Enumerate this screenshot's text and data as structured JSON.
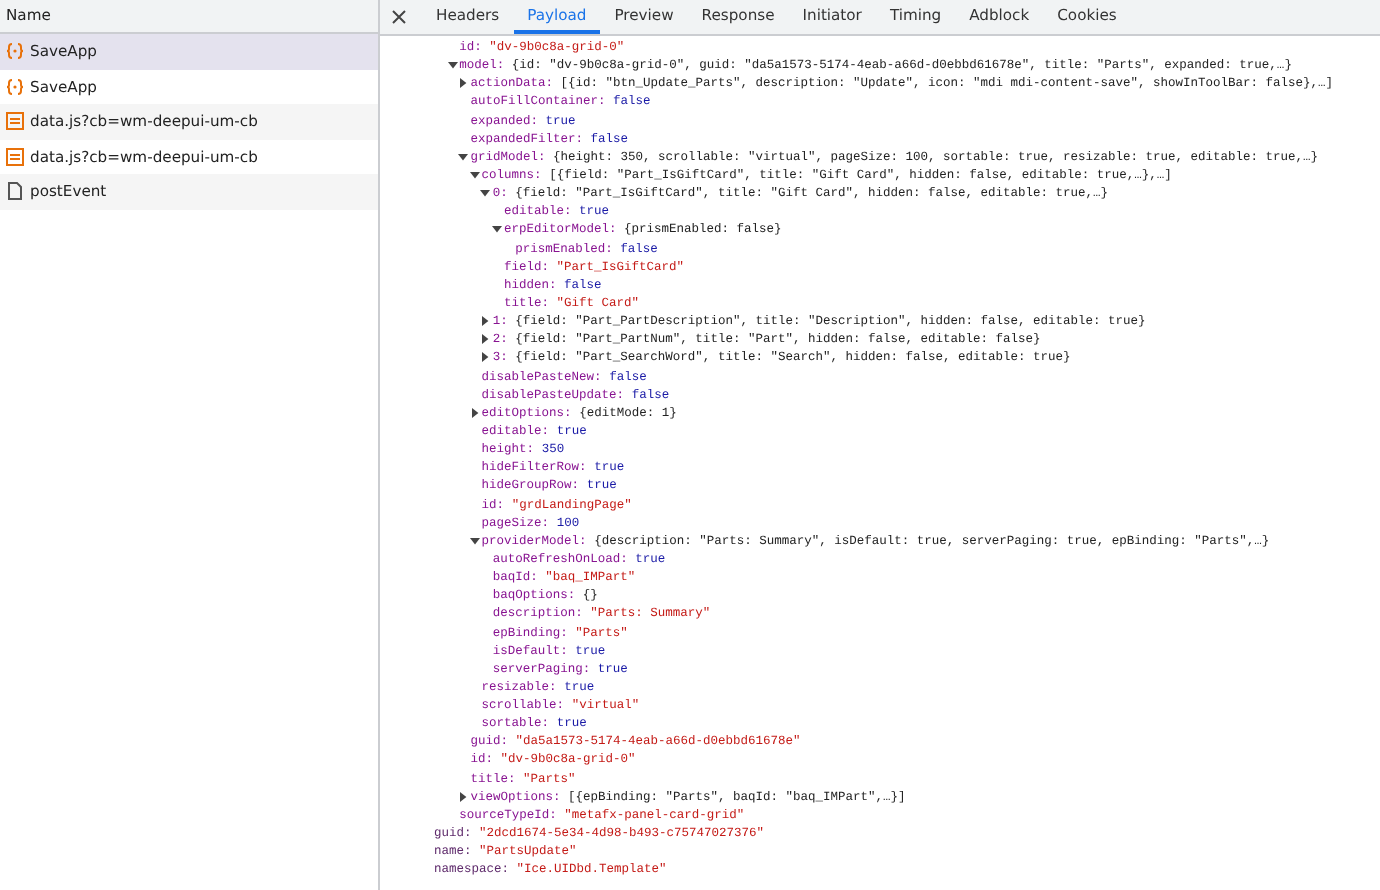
{
  "requests": {
    "header": "Name",
    "items": [
      {
        "name": "SaveApp",
        "kind": "xhr",
        "selected": true
      },
      {
        "name": "SaveApp",
        "kind": "xhr",
        "selected": false
      },
      {
        "name": "data.js?cb=wm-deepui-um-cb",
        "kind": "script",
        "selected": false
      },
      {
        "name": "data.js?cb=wm-deepui-um-cb",
        "kind": "script",
        "selected": false
      },
      {
        "name": "postEvent",
        "kind": "doc",
        "selected": false
      }
    ]
  },
  "tabs": [
    {
      "label": "Headers",
      "selected": false
    },
    {
      "label": "Payload",
      "selected": true
    },
    {
      "label": "Preview",
      "selected": false
    },
    {
      "label": "Response",
      "selected": false
    },
    {
      "label": "Initiator",
      "selected": false
    },
    {
      "label": "Timing",
      "selected": false
    },
    {
      "label": "Adblock",
      "selected": false
    },
    {
      "label": "Cookies",
      "selected": false
    }
  ],
  "tree": [
    {
      "children": [
        {
          "key": "id:",
          "value": "\"dv-9b0c8a-grid-0\"",
          "kind": "string"
        },
        {
          "key": "model:",
          "value": "{id: \"dv-9b0c8a-grid-0\", guid: \"da5a1573-5174-4eab-a66d-d0ebbd61678e\", title: \"Parts\", expanded: true,…}",
          "kind": "object",
          "expanded": true,
          "children": [
            {
              "key": "actionData:",
              "value": "[{id: \"btn_Update_Parts\", description: \"Update\", icon: \"mdi mdi-content-save\", showInToolBar: false},…]",
              "kind": "object",
              "expanded": false
            },
            {
              "key": "autoFillContainer:",
              "value": "false",
              "kind": "literal"
            },
            {
              "key": "expanded:",
              "value": "true",
              "kind": "literal"
            },
            {
              "key": "expandedFilter:",
              "value": "false",
              "kind": "literal"
            },
            {
              "key": "gridModel:",
              "value": "{height: 350, scrollable: \"virtual\", pageSize: 100, sortable: true, resizable: true, editable: true,…}",
              "kind": "object",
              "expanded": true,
              "children": [
                {
                  "key": "columns:",
                  "value": "[{field: \"Part_IsGiftCard\", title: \"Gift Card\", hidden: false, editable: true,…},…]",
                  "kind": "object",
                  "expanded": true,
                  "children": [
                    {
                      "key": "0:",
                      "value": "{field: \"Part_IsGiftCard\", title: \"Gift Card\", hidden: false, editable: true,…}",
                      "kind": "object",
                      "expanded": true,
                      "children": [
                        {
                          "key": "editable:",
                          "value": "true",
                          "kind": "literal"
                        },
                        {
                          "key": "erpEditorModel:",
                          "value": "{prismEnabled: false}",
                          "kind": "object",
                          "expanded": true,
                          "children": [
                            {
                              "key": "prismEnabled:",
                              "value": "false",
                              "kind": "literal"
                            }
                          ]
                        },
                        {
                          "key": "field:",
                          "value": "\"Part_IsGiftCard\"",
                          "kind": "string"
                        },
                        {
                          "key": "hidden:",
                          "value": "false",
                          "kind": "literal"
                        },
                        {
                          "key": "title:",
                          "value": "\"Gift Card\"",
                          "kind": "string"
                        }
                      ]
                    },
                    {
                      "key": "1:",
                      "value": "{field: \"Part_PartDescription\", title: \"Description\", hidden: false, editable: true}",
                      "kind": "object",
                      "expanded": false
                    },
                    {
                      "key": "2:",
                      "value": "{field: \"Part_PartNum\", title: \"Part\", hidden: false, editable: false}",
                      "kind": "object",
                      "expanded": false
                    },
                    {
                      "key": "3:",
                      "value": "{field: \"Part_SearchWord\", title: \"Search\", hidden: false, editable: true}",
                      "kind": "object",
                      "expanded": false
                    }
                  ]
                },
                {
                  "key": "disablePasteNew:",
                  "value": "false",
                  "kind": "literal"
                },
                {
                  "key": "disablePasteUpdate:",
                  "value": "false",
                  "kind": "literal"
                },
                {
                  "key": "editOptions:",
                  "value": "{editMode: 1}",
                  "kind": "object",
                  "expanded": false
                },
                {
                  "key": "editable:",
                  "value": "true",
                  "kind": "literal"
                },
                {
                  "key": "height:",
                  "value": "350",
                  "kind": "literal"
                },
                {
                  "key": "hideFilterRow:",
                  "value": "true",
                  "kind": "literal"
                },
                {
                  "key": "hideGroupRow:",
                  "value": "true",
                  "kind": "literal"
                },
                {
                  "key": "id:",
                  "value": "\"grdLandingPage\"",
                  "kind": "string"
                },
                {
                  "key": "pageSize:",
                  "value": "100",
                  "kind": "literal"
                },
                {
                  "key": "providerModel:",
                  "value": "{description: \"Parts: Summary\", isDefault: true, serverPaging: true, epBinding: \"Parts\",…}",
                  "kind": "object",
                  "expanded": true,
                  "children": [
                    {
                      "key": "autoRefreshOnLoad:",
                      "value": "true",
                      "kind": "literal"
                    },
                    {
                      "key": "baqId:",
                      "value": "\"baq_IMPart\"",
                      "kind": "string"
                    },
                    {
                      "key": "baqOptions:",
                      "value": "{}",
                      "kind": "object"
                    },
                    {
                      "key": "description:",
                      "value": "\"Parts: Summary\"",
                      "kind": "string"
                    },
                    {
                      "key": "epBinding:",
                      "value": "\"Parts\"",
                      "kind": "string"
                    },
                    {
                      "key": "isDefault:",
                      "value": "true",
                      "kind": "literal"
                    },
                    {
                      "key": "serverPaging:",
                      "value": "true",
                      "kind": "literal"
                    }
                  ]
                },
                {
                  "key": "resizable:",
                  "value": "true",
                  "kind": "literal"
                },
                {
                  "key": "scrollable:",
                  "value": "\"virtual\"",
                  "kind": "string"
                },
                {
                  "key": "sortable:",
                  "value": "true",
                  "kind": "literal"
                }
              ]
            },
            {
              "key": "guid:",
              "value": "\"da5a1573-5174-4eab-a66d-d0ebbd61678e\"",
              "kind": "string"
            },
            {
              "key": "id:",
              "value": "\"dv-9b0c8a-grid-0\"",
              "kind": "string"
            },
            {
              "key": "title:",
              "value": "\"Parts\"",
              "kind": "string"
            },
            {
              "key": "viewOptions:",
              "value": "[{epBinding: \"Parts\", baqId: \"baq_IMPart\",…}]",
              "kind": "object",
              "expanded": false
            }
          ]
        },
        {
          "key": "sourceTypeId:",
          "value": "\"metafx-panel-card-grid\"",
          "kind": "string"
        }
      ]
    },
    {
      "key": "guid:",
      "value": "\"2dcd1674-5e34-4d98-b493-c75747027376\"",
      "kind": "string"
    },
    {
      "key": "name:",
      "value": "\"PartsUpdate\"",
      "kind": "string"
    },
    {
      "key": "namespace:",
      "value": "\"Ice.UIDbd.Template\"",
      "kind": "string"
    }
  ]
}
